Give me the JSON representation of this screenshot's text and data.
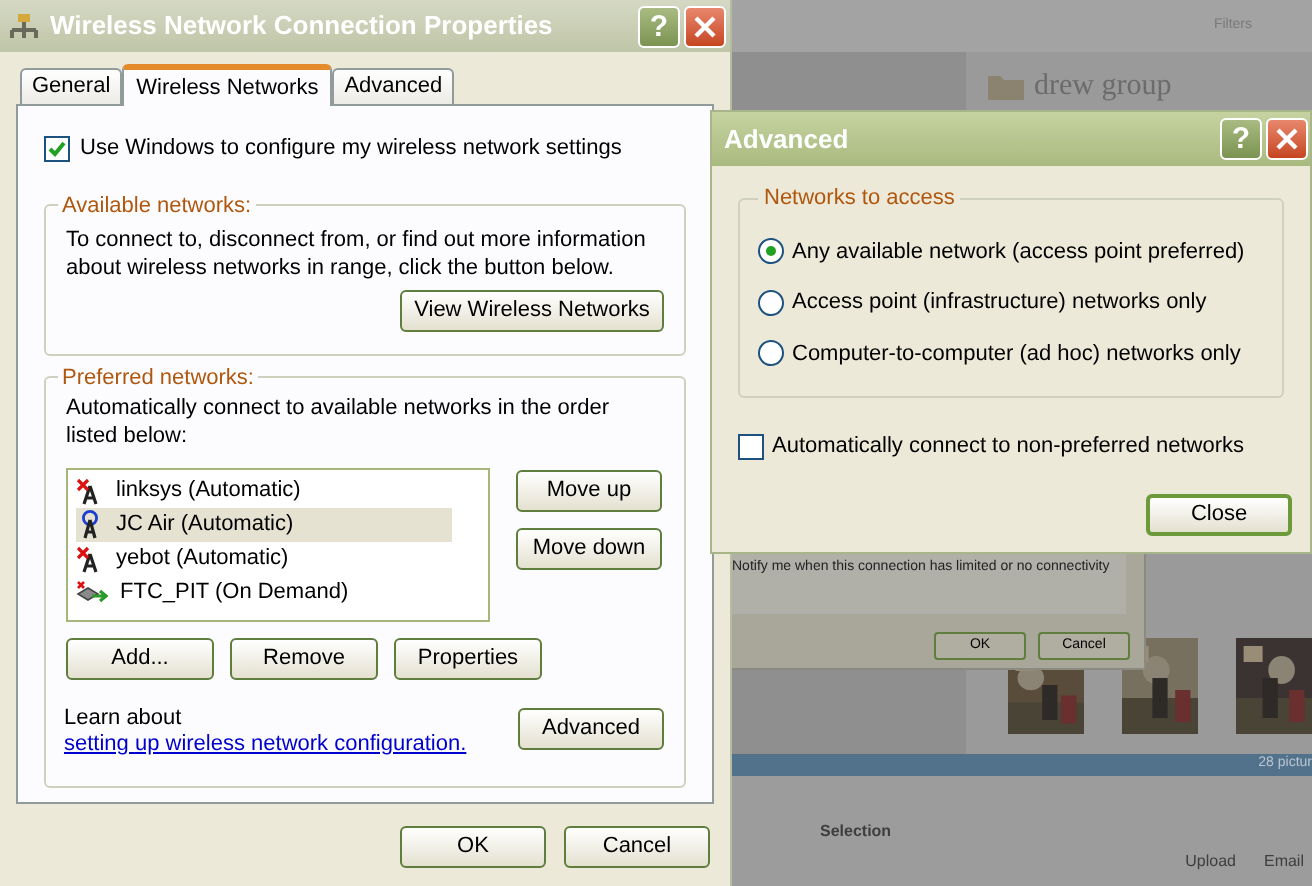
{
  "background_app": {
    "filters_label": "Filters",
    "folder_name": "drew group",
    "photo_count": "28 pictur",
    "selection_label": "Selection",
    "actions": [
      "Upload",
      "Email"
    ]
  },
  "behind_dialog": {
    "text": "Notify me when this connection has limited or no connectivity",
    "buttons": [
      "OK",
      "Cancel"
    ]
  },
  "properties_window": {
    "title": "Wireless Network Connection Properties",
    "help_glyph": "?",
    "tabs": [
      {
        "label": "General",
        "selected": false
      },
      {
        "label": "Wireless Networks",
        "selected": true
      },
      {
        "label": "Advanced",
        "selected": false
      }
    ],
    "use_windows": {
      "label": "Use Windows to configure my wireless network settings",
      "checked": true
    },
    "available": {
      "legend": "Available networks:",
      "text": "To connect to, disconnect from, or find out more information about wireless networks in range, click the button below.",
      "button": "View Wireless Networks"
    },
    "preferred": {
      "legend": "Preferred networks:",
      "text": "Automatically connect to available networks in the order listed below:",
      "networks": [
        {
          "name": "linksys (Automatic)",
          "kind": "unavailable",
          "selected": false
        },
        {
          "name": "JC Air (Automatic)",
          "kind": "available",
          "selected": true
        },
        {
          "name": "yebot (Automatic)",
          "kind": "unavailable",
          "selected": false
        },
        {
          "name": "FTC_PIT (On Demand)",
          "kind": "on_demand",
          "selected": false
        }
      ],
      "side_buttons": [
        "Move up",
        "Move down"
      ],
      "buttons": [
        "Add...",
        "Remove",
        "Properties"
      ],
      "learn_prefix": "Learn about",
      "learn_link": "setting up wireless network configuration.",
      "advanced_button": "Advanced"
    },
    "buttons": [
      "OK",
      "Cancel"
    ]
  },
  "advanced_window": {
    "title": "Advanced",
    "help_glyph": "?",
    "legend": "Networks to access",
    "options": [
      {
        "label": "Any available network (access point preferred)",
        "selected": true
      },
      {
        "label": "Access point (infrastructure) networks only",
        "selected": false
      },
      {
        "label": "Computer-to-computer (ad hoc) networks only",
        "selected": false
      }
    ],
    "auto_connect": {
      "label": "Automatically connect to non-preferred networks",
      "checked": false
    },
    "close_button": "Close"
  }
}
